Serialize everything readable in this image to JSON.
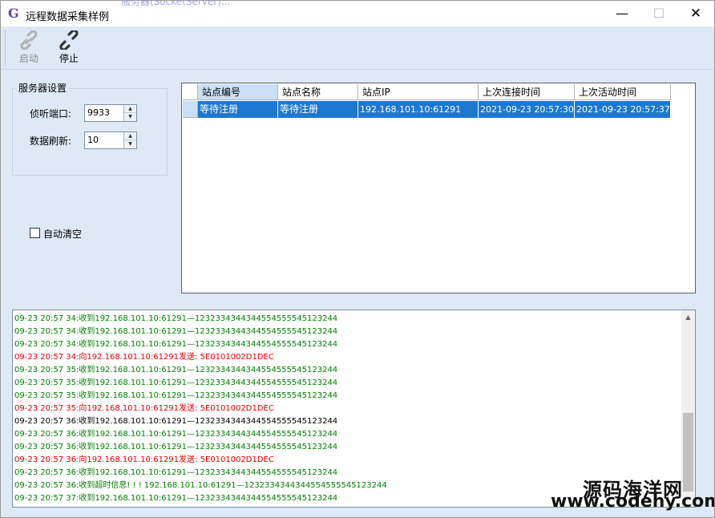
{
  "window": {
    "app_icon": "G",
    "title": "远程数据采集样例",
    "background_title_text": "服务器(SocketServer)...",
    "min_glyph": "—",
    "max_glyph": "☐",
    "close_glyph": "✕"
  },
  "toolbar": {
    "start_label": "启动",
    "start_enabled": false,
    "stop_label": "停止",
    "icons": {
      "start": "link-icon",
      "stop": "unlink-icon"
    }
  },
  "server": {
    "group_title": "服务器设置",
    "port_label": "侦听端口:",
    "port_value": "9933",
    "refresh_label": "数据刷新:",
    "refresh_value": "10",
    "autoclear_label": "自动清空",
    "autoclear_checked": false
  },
  "grid": {
    "columns": [
      "站点编号",
      "站点名称",
      "站点IP",
      "上次连接时间",
      "上次活动时间"
    ],
    "rows": [
      [
        "等待注册",
        "等待注册",
        "192.168.101.10:61291",
        "2021-09-23 20:57:30",
        "2021-09-23 20:57:37"
      ]
    ],
    "selected_row": 0,
    "selection_color": "#1e78d2"
  },
  "log": {
    "colors": {
      "recv": "#008000",
      "send": "#e00000",
      "other": "#000000"
    },
    "lines": [
      {
        "text": "09-23 20:57 34:收到192.168.101.10:61291—1232334344344554555545123244",
        "kind": "recv"
      },
      {
        "text": "09-23 20:57 34:收到192.168.101.10:61291—1232334344344554555545123244",
        "kind": "recv"
      },
      {
        "text": "09-23 20:57 34:收到192.168.101.10:61291—1232334344344554555545123244",
        "kind": "recv"
      },
      {
        "text": "09-23 20:57 34:向192.168.101.10:61291发送: 5E0101002D1DEC",
        "kind": "send"
      },
      {
        "text": "09-23 20:57 35:收到192.168.101.10:61291—1232334344344554555545123244",
        "kind": "recv"
      },
      {
        "text": "09-23 20:57 35:收到192.168.101.10:61291—1232334344344554555545123244",
        "kind": "recv"
      },
      {
        "text": "09-23 20:57 35:收到192.168.101.10:61291—1232334344344554555545123244",
        "kind": "recv"
      },
      {
        "text": "09-23 20:57 35:向192.168.101.10:61291发送: 5E0101002D1DEC",
        "kind": "send"
      },
      {
        "text": "09-23 20:57 36:收到192.168.101.10:61291—1232334344344554555545123244",
        "kind": "other"
      },
      {
        "text": "09-23 20:57 36:收到192.168.101.10:61291—1232334344344554555545123244",
        "kind": "recv"
      },
      {
        "text": "09-23 20:57 36:收到192.168.101.10:61291—1232334344344554555545123244",
        "kind": "recv"
      },
      {
        "text": "09-23 20:57 36:向192.168.101.10:61291发送: 5E0101002D1DEC",
        "kind": "send"
      },
      {
        "text": "09-23 20:57 36:收到192.168.101.10:61291—1232334344344554555545123244",
        "kind": "recv"
      },
      {
        "text": "09-23 20:57 36:收到超时信息! ! ! 192.168.101.10:61291—1232334344344554555545123244",
        "kind": "recv"
      },
      {
        "text": "09-23 20:57 37:收到192.168.101.10:61291—1232334344344554555545123244",
        "kind": "recv"
      }
    ]
  },
  "watermark": {
    "line1": "源码海洋网",
    "line2": "www.codehy.com"
  }
}
